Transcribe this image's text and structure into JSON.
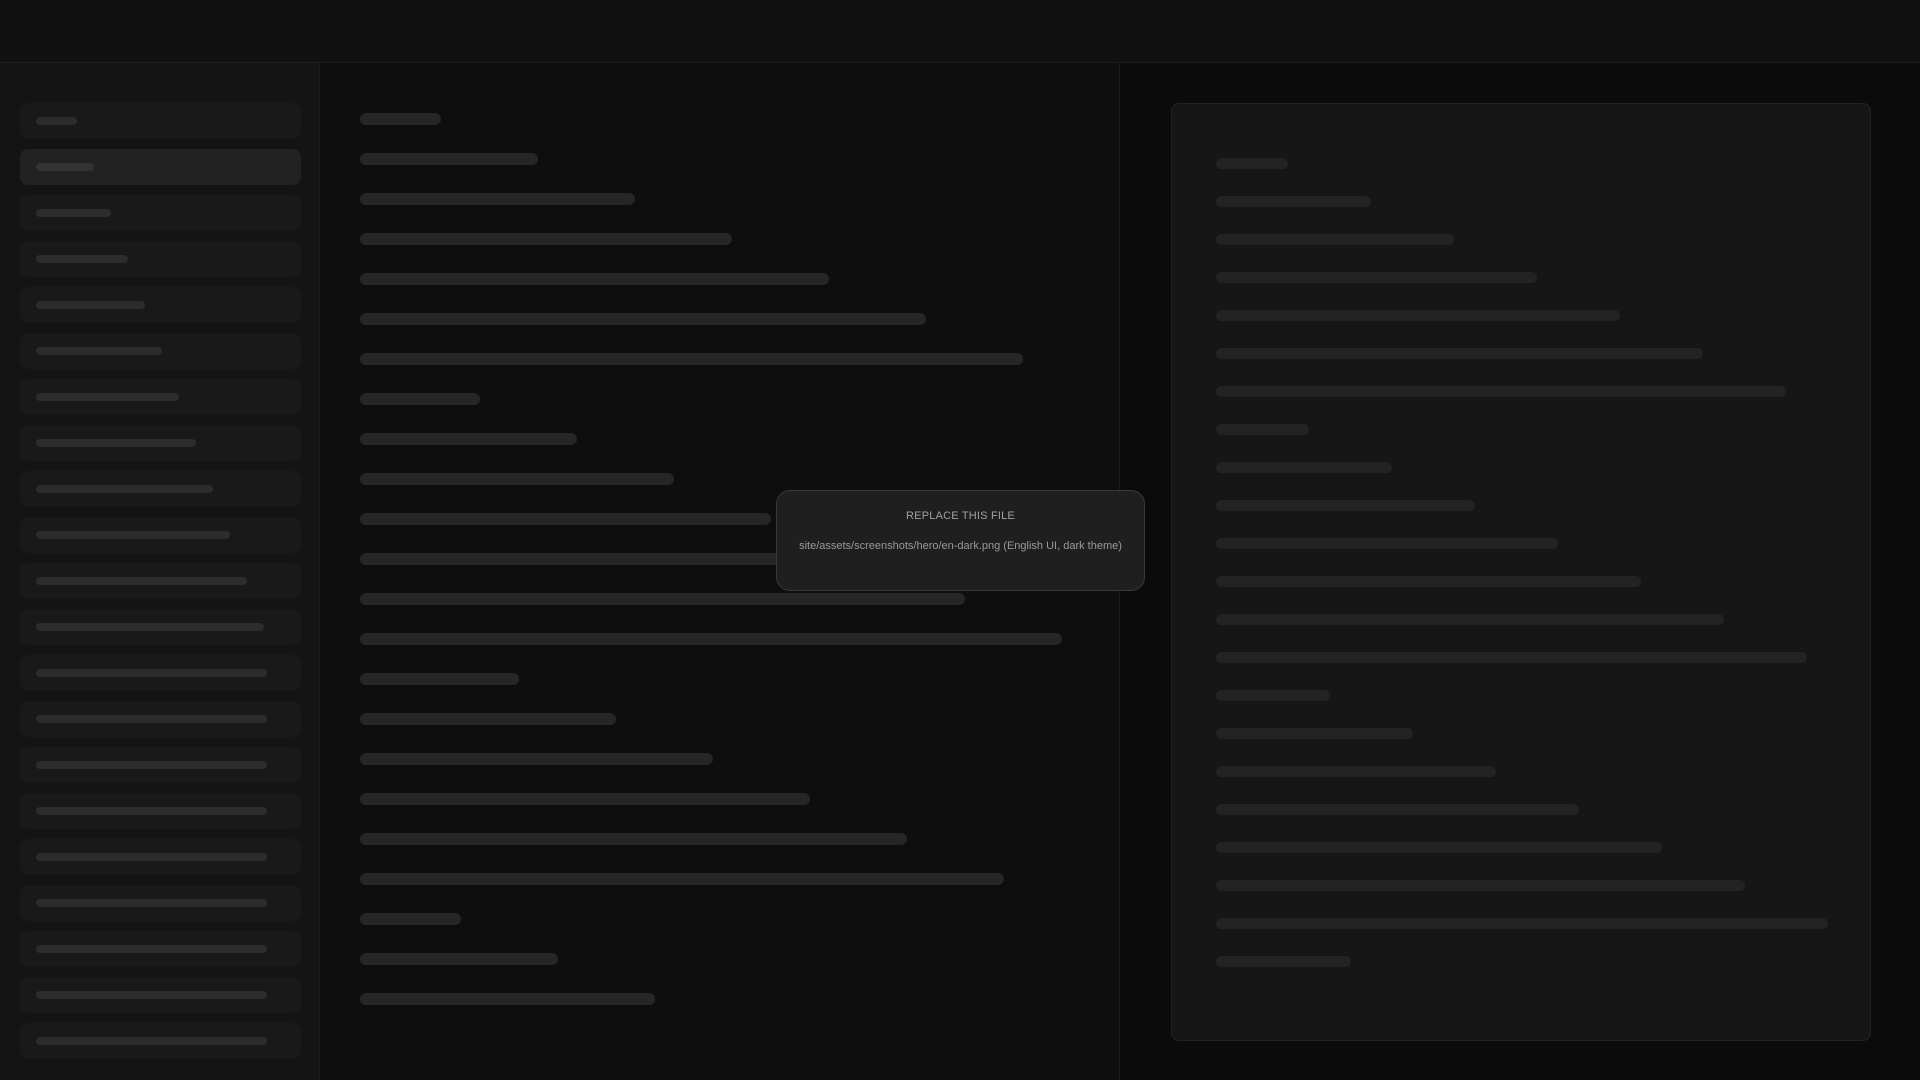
{
  "notice": {
    "title": "REPLACE THIS FILE",
    "path": "site/assets/screenshots/hero/en-dark.png   (English UI, dark theme)"
  },
  "colors": {
    "background": "#0c0c0c",
    "topbar": "#111111",
    "sidebar": "#141414",
    "sidebar_item": "#191919",
    "sidebar_item_active": "#222222",
    "editor": "#0e0e0e",
    "preview_card": "#161616",
    "notice_bg": "#1f1f1f",
    "notice_border": "#3a3a3a",
    "placeholder_bar": "#262626"
  },
  "sidebar": {
    "item_count": 21,
    "active_index": 1
  }
}
